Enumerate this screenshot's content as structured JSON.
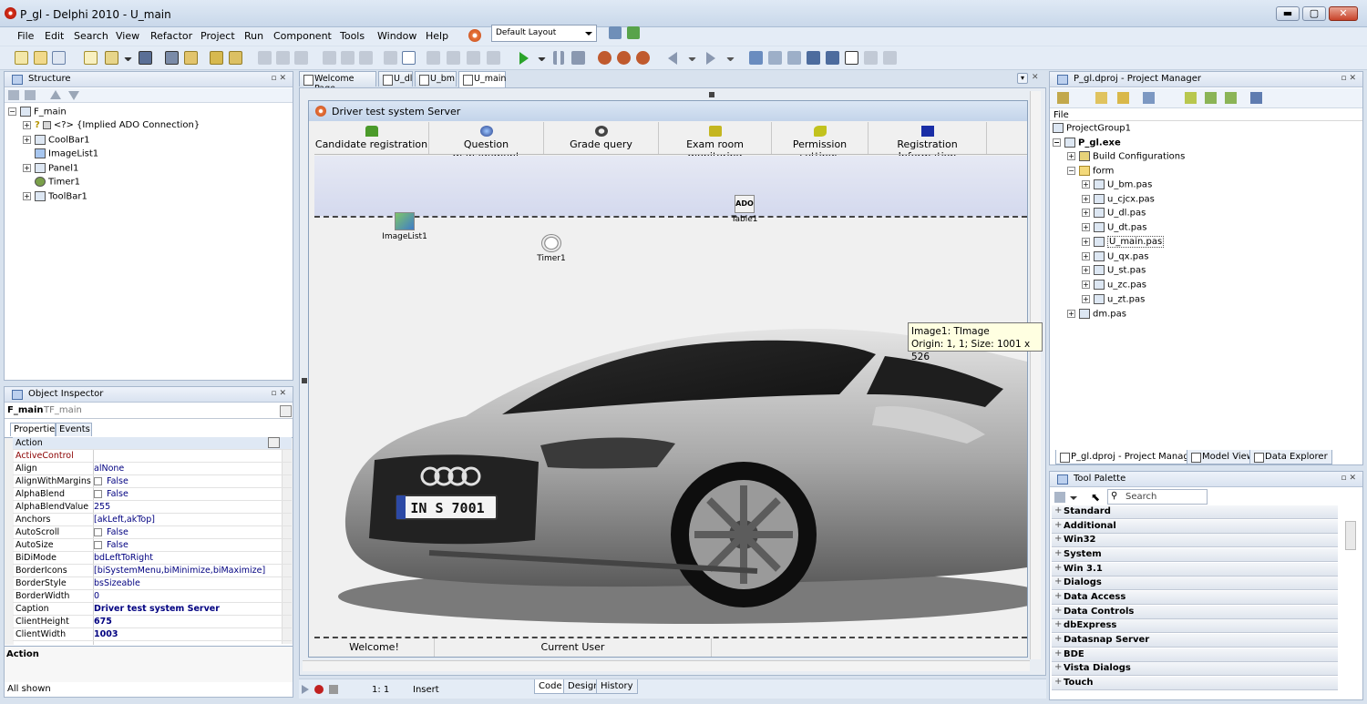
{
  "window": {
    "title": "P_gl - Delphi 2010 - U_main",
    "min": "▬",
    "max": "▢",
    "close": "✕"
  },
  "menu": [
    "File",
    "Edit",
    "Search",
    "View",
    "Refactor",
    "Project",
    "Run",
    "Component",
    "Tools",
    "Window",
    "Help"
  ],
  "layout_select": "Default Layout",
  "structure": {
    "title": "Structure",
    "root": "F_main",
    "items": [
      "<?> {Implied ADO Connection}",
      "CoolBar1",
      "ImageList1",
      "Panel1",
      "Timer1",
      "ToolBar1"
    ]
  },
  "object_inspector": {
    "title": "Object Inspector",
    "selected_name": "F_main",
    "selected_type": "TF_main",
    "tabs": [
      "Properties",
      "Events"
    ],
    "properties": [
      {
        "name": "Action",
        "value": ""
      },
      {
        "name": "ActiveControl",
        "value": ""
      },
      {
        "name": "Align",
        "value": "alNone"
      },
      {
        "name": "AlignWithMargins",
        "value": "False"
      },
      {
        "name": "AlphaBlend",
        "value": "False"
      },
      {
        "name": "AlphaBlendValue",
        "value": "255"
      },
      {
        "name": "Anchors",
        "value": "[akLeft,akTop]"
      },
      {
        "name": "AutoScroll",
        "value": "False"
      },
      {
        "name": "AutoSize",
        "value": "False"
      },
      {
        "name": "BiDiMode",
        "value": "bdLeftToRight"
      },
      {
        "name": "BorderIcons",
        "value": "[biSystemMenu,biMinimize,biMaximize]"
      },
      {
        "name": "BorderStyle",
        "value": "bsSizeable"
      },
      {
        "name": "BorderWidth",
        "value": "0"
      },
      {
        "name": "Caption",
        "value": "Driver test system Server"
      },
      {
        "name": "ClientHeight",
        "value": "675"
      },
      {
        "name": "ClientWidth",
        "value": "1003"
      }
    ],
    "help_title": "Action",
    "status": "All shown"
  },
  "editor_tabs": [
    "Welcome Page",
    "U_dl",
    "U_bm",
    "U_main"
  ],
  "form": {
    "caption": "Driver test system Server",
    "buttons": [
      "Candidate registration",
      "Question management",
      "Grade query",
      "Exam room monitoring",
      "Permission settings",
      "Registration Information"
    ],
    "components": {
      "table": "Table1",
      "imagelist": "ImageList1",
      "timer": "Timer1",
      "ado": "ADO"
    },
    "status": [
      "Welcome!",
      "Current User"
    ]
  },
  "hint": {
    "line1": "Image1: TImage",
    "line2": "Origin: 1, 1; Size: 1001 x 526"
  },
  "car_plate": "IN S 7001",
  "editor_status": {
    "pos": "1:    1",
    "mode": "Insert",
    "tabs": [
      "Code",
      "Design",
      "History"
    ]
  },
  "project_manager": {
    "title": "P_gl.dproj - Project Manager",
    "header": "File",
    "group": "ProjectGroup1",
    "project": "P_gl.exe",
    "build": "Build Configurations",
    "folder": "form",
    "files": [
      "U_bm.pas",
      "u_cjcx.pas",
      "U_dl.pas",
      "U_dt.pas",
      "U_main.pas",
      "U_qx.pas",
      "U_st.pas",
      "u_zc.pas",
      "u_zt.pas"
    ],
    "dm": "dm.pas",
    "tabs": [
      "P_gl.dproj - Project Manager",
      "Model View",
      "Data Explorer"
    ]
  },
  "tool_palette": {
    "title": "Tool Palette",
    "search_placeholder": "Search",
    "categories": [
      "Standard",
      "Additional",
      "Win32",
      "System",
      "Win 3.1",
      "Dialogs",
      "Data Access",
      "Data Controls",
      "dbExpress",
      "Datasnap Server",
      "BDE",
      "Vista Dialogs",
      "Touch"
    ]
  },
  "colors": {
    "accent": "#c3d4ea",
    "panel_border": "#a7b7cc",
    "value_blue": "#000080"
  }
}
